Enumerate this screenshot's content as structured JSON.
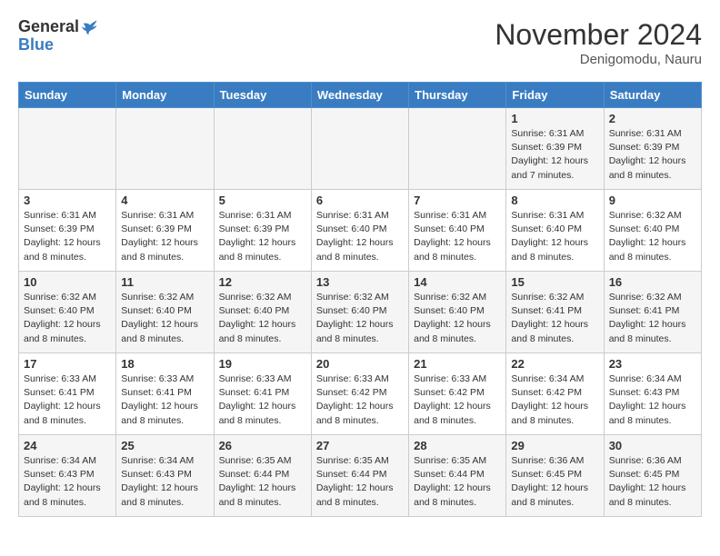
{
  "logo": {
    "general": "General",
    "blue": "Blue"
  },
  "header": {
    "month": "November 2024",
    "location": "Denigomodu, Nauru"
  },
  "days_of_week": [
    "Sunday",
    "Monday",
    "Tuesday",
    "Wednesday",
    "Thursday",
    "Friday",
    "Saturday"
  ],
  "weeks": [
    [
      {
        "day": "",
        "info": ""
      },
      {
        "day": "",
        "info": ""
      },
      {
        "day": "",
        "info": ""
      },
      {
        "day": "",
        "info": ""
      },
      {
        "day": "",
        "info": ""
      },
      {
        "day": "1",
        "info": "Sunrise: 6:31 AM\nSunset: 6:39 PM\nDaylight: 12 hours and 7 minutes."
      },
      {
        "day": "2",
        "info": "Sunrise: 6:31 AM\nSunset: 6:39 PM\nDaylight: 12 hours and 8 minutes."
      }
    ],
    [
      {
        "day": "3",
        "info": "Sunrise: 6:31 AM\nSunset: 6:39 PM\nDaylight: 12 hours and 8 minutes."
      },
      {
        "day": "4",
        "info": "Sunrise: 6:31 AM\nSunset: 6:39 PM\nDaylight: 12 hours and 8 minutes."
      },
      {
        "day": "5",
        "info": "Sunrise: 6:31 AM\nSunset: 6:39 PM\nDaylight: 12 hours and 8 minutes."
      },
      {
        "day": "6",
        "info": "Sunrise: 6:31 AM\nSunset: 6:40 PM\nDaylight: 12 hours and 8 minutes."
      },
      {
        "day": "7",
        "info": "Sunrise: 6:31 AM\nSunset: 6:40 PM\nDaylight: 12 hours and 8 minutes."
      },
      {
        "day": "8",
        "info": "Sunrise: 6:31 AM\nSunset: 6:40 PM\nDaylight: 12 hours and 8 minutes."
      },
      {
        "day": "9",
        "info": "Sunrise: 6:32 AM\nSunset: 6:40 PM\nDaylight: 12 hours and 8 minutes."
      }
    ],
    [
      {
        "day": "10",
        "info": "Sunrise: 6:32 AM\nSunset: 6:40 PM\nDaylight: 12 hours and 8 minutes."
      },
      {
        "day": "11",
        "info": "Sunrise: 6:32 AM\nSunset: 6:40 PM\nDaylight: 12 hours and 8 minutes."
      },
      {
        "day": "12",
        "info": "Sunrise: 6:32 AM\nSunset: 6:40 PM\nDaylight: 12 hours and 8 minutes."
      },
      {
        "day": "13",
        "info": "Sunrise: 6:32 AM\nSunset: 6:40 PM\nDaylight: 12 hours and 8 minutes."
      },
      {
        "day": "14",
        "info": "Sunrise: 6:32 AM\nSunset: 6:40 PM\nDaylight: 12 hours and 8 minutes."
      },
      {
        "day": "15",
        "info": "Sunrise: 6:32 AM\nSunset: 6:41 PM\nDaylight: 12 hours and 8 minutes."
      },
      {
        "day": "16",
        "info": "Sunrise: 6:32 AM\nSunset: 6:41 PM\nDaylight: 12 hours and 8 minutes."
      }
    ],
    [
      {
        "day": "17",
        "info": "Sunrise: 6:33 AM\nSunset: 6:41 PM\nDaylight: 12 hours and 8 minutes."
      },
      {
        "day": "18",
        "info": "Sunrise: 6:33 AM\nSunset: 6:41 PM\nDaylight: 12 hours and 8 minutes."
      },
      {
        "day": "19",
        "info": "Sunrise: 6:33 AM\nSunset: 6:41 PM\nDaylight: 12 hours and 8 minutes."
      },
      {
        "day": "20",
        "info": "Sunrise: 6:33 AM\nSunset: 6:42 PM\nDaylight: 12 hours and 8 minutes."
      },
      {
        "day": "21",
        "info": "Sunrise: 6:33 AM\nSunset: 6:42 PM\nDaylight: 12 hours and 8 minutes."
      },
      {
        "day": "22",
        "info": "Sunrise: 6:34 AM\nSunset: 6:42 PM\nDaylight: 12 hours and 8 minutes."
      },
      {
        "day": "23",
        "info": "Sunrise: 6:34 AM\nSunset: 6:43 PM\nDaylight: 12 hours and 8 minutes."
      }
    ],
    [
      {
        "day": "24",
        "info": "Sunrise: 6:34 AM\nSunset: 6:43 PM\nDaylight: 12 hours and 8 minutes."
      },
      {
        "day": "25",
        "info": "Sunrise: 6:34 AM\nSunset: 6:43 PM\nDaylight: 12 hours and 8 minutes."
      },
      {
        "day": "26",
        "info": "Sunrise: 6:35 AM\nSunset: 6:44 PM\nDaylight: 12 hours and 8 minutes."
      },
      {
        "day": "27",
        "info": "Sunrise: 6:35 AM\nSunset: 6:44 PM\nDaylight: 12 hours and 8 minutes."
      },
      {
        "day": "28",
        "info": "Sunrise: 6:35 AM\nSunset: 6:44 PM\nDaylight: 12 hours and 8 minutes."
      },
      {
        "day": "29",
        "info": "Sunrise: 6:36 AM\nSunset: 6:45 PM\nDaylight: 12 hours and 8 minutes."
      },
      {
        "day": "30",
        "info": "Sunrise: 6:36 AM\nSunset: 6:45 PM\nDaylight: 12 hours and 8 minutes."
      }
    ]
  ]
}
